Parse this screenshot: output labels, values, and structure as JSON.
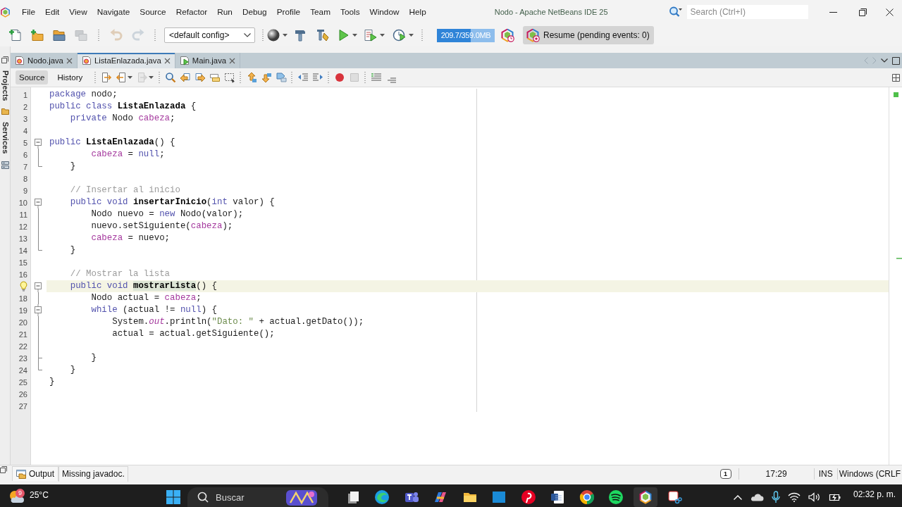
{
  "window": {
    "title": "Nodo - Apache NetBeans IDE 25"
  },
  "menu": [
    "File",
    "Edit",
    "View",
    "Navigate",
    "Source",
    "Refactor",
    "Run",
    "Debug",
    "Profile",
    "Team",
    "Tools",
    "Window",
    "Help"
  ],
  "search": {
    "placeholder": "Search (Ctrl+I)"
  },
  "toolbar": {
    "file_buttons": [
      {
        "kind": "new_file",
        "disabled": false
      },
      {
        "kind": "new_project",
        "disabled": false
      },
      {
        "kind": "open_project",
        "disabled": false
      },
      {
        "kind": "close_project",
        "disabled": true
      }
    ],
    "edit_buttons": [
      {
        "kind": "undo",
        "disabled": true
      },
      {
        "kind": "redo",
        "disabled": true
      }
    ],
    "config": {
      "value": "<default config>"
    },
    "run_buttons": [
      {
        "kind": "browser",
        "dropdown": true
      },
      {
        "kind": "build",
        "dropdown": false
      },
      {
        "kind": "clean_build",
        "dropdown": false
      },
      {
        "kind": "run",
        "dropdown": true
      },
      {
        "kind": "run_file",
        "dropdown": true
      },
      {
        "kind": "profile",
        "dropdown": true
      }
    ],
    "memory": {
      "text": "209.7/359.0MB",
      "level": 0.58
    },
    "resume": {
      "label": "Resume (pending events: 0)"
    }
  },
  "side_tabs": [
    {
      "label": "Projects"
    },
    {
      "label": "Services"
    }
  ],
  "editor_tabs": [
    {
      "label": "Nodo.java",
      "kind": "class",
      "selected": false
    },
    {
      "label": "ListaEnlazada.java",
      "kind": "class",
      "selected": true
    },
    {
      "label": "Main.java",
      "kind": "main",
      "selected": false
    }
  ],
  "editor_toolbar": {
    "views": [
      {
        "label": "Source",
        "selected": true
      },
      {
        "label": "History",
        "selected": false
      }
    ],
    "tool_groups": [
      [
        {
          "kind": "last_edit",
          "disabled": false,
          "dropdown": false
        },
        {
          "kind": "back",
          "disabled": false,
          "dropdown": true
        },
        {
          "kind": "forward",
          "disabled": true,
          "dropdown": true
        }
      ],
      [
        {
          "kind": "find",
          "disabled": false,
          "dropdown": false
        },
        {
          "kind": "find_previous",
          "disabled": false,
          "dropdown": false
        },
        {
          "kind": "find_next",
          "disabled": false,
          "dropdown": false
        },
        {
          "kind": "highlight",
          "disabled": false,
          "dropdown": false
        },
        {
          "kind": "select",
          "disabled": false,
          "dropdown": false
        }
      ],
      [
        {
          "kind": "bookmark_previous",
          "disabled": false,
          "dropdown": false
        },
        {
          "kind": "bookmark_next",
          "disabled": false,
          "dropdown": false
        },
        {
          "kind": "bookmark_toggle",
          "disabled": false,
          "dropdown": false
        }
      ],
      [
        {
          "kind": "shift_left",
          "disabled": false,
          "dropdown": false
        },
        {
          "kind": "shift_right",
          "disabled": false,
          "dropdown": false
        }
      ],
      [
        {
          "kind": "record",
          "disabled": false,
          "dropdown": false
        },
        {
          "kind": "stop",
          "disabled": true,
          "dropdown": false
        }
      ],
      [
        {
          "kind": "comment",
          "disabled": false,
          "dropdown": false
        },
        {
          "kind": "uncomment",
          "disabled": false,
          "dropdown": false
        }
      ]
    ]
  },
  "editor": {
    "lines": [
      {
        "number": "1",
        "current": false,
        "hint": false,
        "tokens": [
          {
            "kind": "keyword",
            "text": "package"
          },
          {
            "kind": "plain",
            "text": " nodo;"
          }
        ]
      },
      {
        "number": "2",
        "current": false,
        "hint": false,
        "tokens": [
          {
            "kind": "keyword",
            "text": "public class "
          },
          {
            "kind": "declaration",
            "text": "ListaEnlazada"
          },
          {
            "kind": "plain",
            "text": " {"
          }
        ]
      },
      {
        "number": "3",
        "current": false,
        "hint": false,
        "tokens": [
          {
            "kind": "keyword",
            "text": "    private "
          },
          {
            "kind": "plain",
            "text": "Nodo "
          },
          {
            "kind": "field",
            "text": "cabeza"
          },
          {
            "kind": "plain",
            "text": ";"
          }
        ]
      },
      {
        "number": "4",
        "current": false,
        "hint": false
      },
      {
        "number": "5",
        "current": false,
        "hint": false,
        "fold": {
          "kind": "start"
        },
        "tokens": [
          {
            "kind": "keyword",
            "text": "public "
          },
          {
            "kind": "declaration",
            "text": "ListaEnlazada"
          },
          {
            "kind": "plain",
            "text": "() {"
          }
        ]
      },
      {
        "number": "6",
        "current": false,
        "hint": false,
        "fold": {
          "kind": "inner"
        },
        "tokens": [
          {
            "kind": "field",
            "text": "        cabeza"
          },
          {
            "kind": "plain",
            "text": " = "
          },
          {
            "kind": "keyword",
            "text": "null"
          },
          {
            "kind": "plain",
            "text": ";"
          }
        ]
      },
      {
        "number": "7",
        "current": false,
        "hint": false,
        "fold": {
          "kind": "end"
        },
        "tokens": [
          {
            "kind": "plain",
            "text": "    }"
          }
        ]
      },
      {
        "number": "8",
        "current": false,
        "hint": false
      },
      {
        "number": "9",
        "current": false,
        "hint": false,
        "tokens": [
          {
            "kind": "comment",
            "text": "    // Insertar al inicio"
          }
        ]
      },
      {
        "number": "10",
        "current": false,
        "hint": false,
        "fold": {
          "kind": "start"
        },
        "tokens": [
          {
            "kind": "keyword",
            "text": "    public void "
          },
          {
            "kind": "declaration",
            "text": "insertarInicio"
          },
          {
            "kind": "plain",
            "text": "("
          },
          {
            "kind": "keyword",
            "text": "int "
          },
          {
            "kind": "plain",
            "text": "valor) {"
          }
        ]
      },
      {
        "number": "11",
        "current": false,
        "hint": false,
        "fold": {
          "kind": "inner"
        },
        "tokens": [
          {
            "kind": "plain",
            "text": "        Nodo nuevo = "
          },
          {
            "kind": "keyword",
            "text": "new "
          },
          {
            "kind": "plain",
            "text": "Nodo(valor);"
          }
        ]
      },
      {
        "number": "12",
        "current": false,
        "hint": false,
        "fold": {
          "kind": "inner"
        },
        "tokens": [
          {
            "kind": "plain",
            "text": "        nuevo.setSiguiente("
          },
          {
            "kind": "field",
            "text": "cabeza"
          },
          {
            "kind": "plain",
            "text": ");"
          }
        ]
      },
      {
        "number": "13",
        "current": false,
        "hint": false,
        "fold": {
          "kind": "inner"
        },
        "tokens": [
          {
            "kind": "field",
            "text": "        cabeza"
          },
          {
            "kind": "plain",
            "text": " = nuevo;"
          }
        ]
      },
      {
        "number": "14",
        "current": false,
        "hint": false,
        "fold": {
          "kind": "end"
        },
        "tokens": [
          {
            "kind": "plain",
            "text": "    }"
          }
        ]
      },
      {
        "number": "15",
        "current": false,
        "hint": false
      },
      {
        "number": "16",
        "current": false,
        "hint": false,
        "tokens": [
          {
            "kind": "comment",
            "text": "    // Mostrar la lista"
          }
        ]
      },
      {
        "current": true,
        "hint": true,
        "fold": {
          "kind": "start"
        },
        "tokens": [
          {
            "kind": "keyword",
            "text": "    public void "
          },
          {
            "kind": "mark",
            "text": "mostrarLista"
          },
          {
            "kind": "plain",
            "text": "() {"
          }
        ]
      },
      {
        "number": "18",
        "current": false,
        "hint": false,
        "fold": {
          "kind": "inner"
        },
        "tokens": [
          {
            "kind": "plain",
            "text": "        Nodo actual = "
          },
          {
            "kind": "field",
            "text": "cabeza"
          },
          {
            "kind": "plain",
            "text": ";"
          }
        ]
      },
      {
        "number": "19",
        "current": false,
        "hint": false,
        "fold": {
          "kind": "nested_start"
        },
        "tokens": [
          {
            "kind": "keyword",
            "text": "        while "
          },
          {
            "kind": "plain",
            "text": "(actual != "
          },
          {
            "kind": "keyword",
            "text": "null"
          },
          {
            "kind": "plain",
            "text": ") {"
          }
        ]
      },
      {
        "number": "20",
        "current": false,
        "hint": false,
        "fold": {
          "kind": "inner"
        },
        "tokens": [
          {
            "kind": "plain",
            "text": "            System."
          },
          {
            "kind": "static",
            "text": "out"
          },
          {
            "kind": "plain",
            "text": ".println("
          },
          {
            "kind": "string",
            "text": "\"Dato: \""
          },
          {
            "kind": "plain",
            "text": " + actual.getDato());"
          }
        ]
      },
      {
        "number": "21",
        "current": false,
        "hint": false,
        "fold": {
          "kind": "inner"
        },
        "tokens": [
          {
            "kind": "plain",
            "text": "            actual = actual.getSiguiente();"
          }
        ]
      },
      {
        "number": "22",
        "current": false,
        "hint": false,
        "fold": {
          "kind": "inner"
        }
      },
      {
        "number": "23",
        "current": false,
        "hint": false,
        "fold": {
          "kind": "nested_end"
        },
        "tokens": [
          {
            "kind": "plain",
            "text": "        }"
          }
        ]
      },
      {
        "number": "24",
        "current": false,
        "hint": false,
        "fold": {
          "kind": "end"
        },
        "tokens": [
          {
            "kind": "plain",
            "text": "    }"
          }
        ]
      },
      {
        "number": "25",
        "current": false,
        "hint": false,
        "tokens": [
          {
            "kind": "plain",
            "text": "}"
          }
        ]
      },
      {
        "number": "26",
        "current": false,
        "hint": false
      },
      {
        "number": "27",
        "current": false,
        "hint": false
      }
    ]
  },
  "status_bar": {
    "output_tab": {
      "label": "Output"
    },
    "message": "Missing javadoc.",
    "notifications": "1",
    "position": "17:29",
    "insert_mode": "INS",
    "line_ending": "Windows (CRLF"
  },
  "taskbar": {
    "weather": {
      "badge": "9",
      "temperature": "25°C"
    },
    "search": {
      "placeholder": "Buscar"
    },
    "apps": [
      {
        "kind": "pages",
        "active": false
      },
      {
        "kind": "swirl",
        "active": false
      },
      {
        "kind": "team",
        "active": false
      },
      {
        "kind": "ribbon",
        "active": false
      },
      {
        "kind": "folder",
        "active": false
      },
      {
        "kind": "tile",
        "active": false
      },
      {
        "kind": "pin",
        "active": false
      },
      {
        "kind": "document",
        "active": false
      },
      {
        "kind": "round",
        "active": false
      },
      {
        "kind": "arcs",
        "active": false
      },
      {
        "kind": "cube",
        "active": true
      },
      {
        "kind": "snip",
        "active": false
      }
    ],
    "clock": {
      "time": "02:32 p. m."
    }
  }
}
